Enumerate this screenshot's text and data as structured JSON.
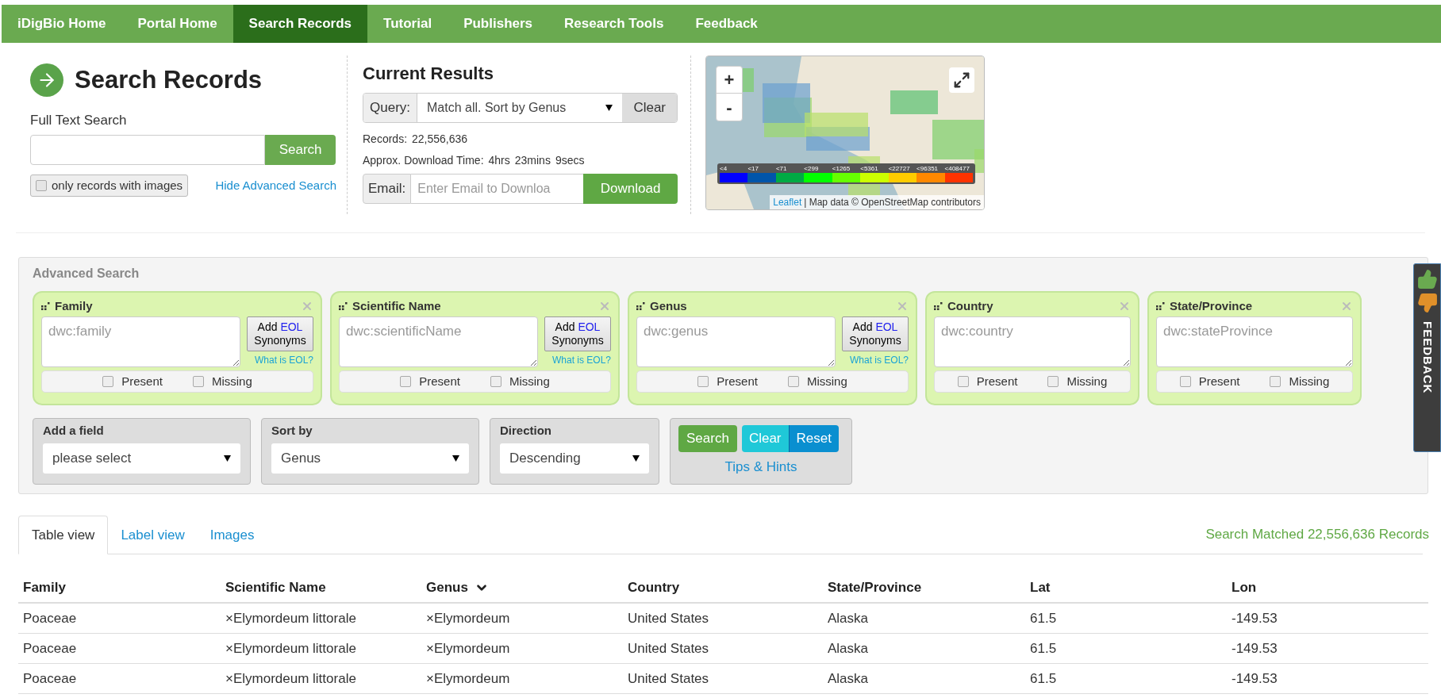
{
  "nav": [
    {
      "label": "iDigBio Home",
      "selected": false
    },
    {
      "label": "Portal Home",
      "selected": false
    },
    {
      "label": "Search Records",
      "selected": true
    },
    {
      "label": "Tutorial",
      "selected": false
    },
    {
      "label": "Publishers",
      "selected": false
    },
    {
      "label": "Research Tools",
      "selected": false
    },
    {
      "label": "Feedback",
      "selected": false
    }
  ],
  "search": {
    "title": "Search Records",
    "label": "Full Text Search",
    "button": "Search",
    "images_only": {
      "label": "only records with images",
      "checked": false
    },
    "advanced_link": "Hide Advanced Search"
  },
  "results": {
    "title": "Current Results",
    "query_label": "Query:",
    "query_value": "Match all. Sort by Genus",
    "clear": "Clear",
    "records_label": "Records:",
    "records": "22,556,636",
    "time_label": "Approx. Download Time:",
    "time_parts": [
      "4hrs",
      "23mins",
      "9secs"
    ],
    "email_label": "Email:",
    "email_placeholder": "Enter Email to Downloa",
    "download": "Download"
  },
  "map": {
    "zoom_in": "+",
    "zoom_out": "-",
    "legend": [
      {
        "label": "<4",
        "color": "#0000ff"
      },
      {
        "label": "<17",
        "color": "#0055aa"
      },
      {
        "label": "<71",
        "color": "#00aa44"
      },
      {
        "label": "<299",
        "color": "#00ff00"
      },
      {
        "label": "<1265",
        "color": "#66ff00"
      },
      {
        "label": "<5361",
        "color": "#ccff00"
      },
      {
        "label": "<22727",
        "color": "#ffcc00"
      },
      {
        "label": "<96351",
        "color": "#ff8800"
      },
      {
        "label": "<408477",
        "color": "#ff3300"
      }
    ],
    "attribution_link": "Leaflet",
    "attribution": "| Map data © OpenStreetMap contributors"
  },
  "advanced": {
    "title": "Advanced Search",
    "fields": [
      {
        "kind": "taxon",
        "name": "Family",
        "placeholder": "dwc:family",
        "eol_add": "Add",
        "eol_name": "EOL",
        "eol_synonyms": "Synonyms",
        "eol_help": "What is EOL?",
        "present": {
          "label": "Present",
          "checked": false
        },
        "missing": {
          "label": "Missing",
          "checked": false
        }
      },
      {
        "kind": "taxon",
        "name": "Scientific Name",
        "placeholder": "dwc:scientificName",
        "eol_add": "Add",
        "eol_name": "EOL",
        "eol_synonyms": "Synonyms",
        "eol_help": "What is EOL?",
        "present": {
          "label": "Present",
          "checked": false
        },
        "missing": {
          "label": "Missing",
          "checked": false
        }
      },
      {
        "kind": "taxon",
        "name": "Genus",
        "placeholder": "dwc:genus",
        "eol_add": "Add",
        "eol_name": "EOL",
        "eol_synonyms": "Synonyms",
        "eol_help": "What is EOL?",
        "present": {
          "label": "Present",
          "checked": false
        },
        "missing": {
          "label": "Missing",
          "checked": false
        }
      },
      {
        "kind": "plain",
        "name": "Country",
        "placeholder": "dwc:country",
        "present": {
          "label": "Present",
          "checked": false
        },
        "missing": {
          "label": "Missing",
          "checked": false
        }
      },
      {
        "kind": "plain",
        "name": "State/Province",
        "placeholder": "dwc:stateProvince",
        "present": {
          "label": "Present",
          "checked": false
        },
        "missing": {
          "label": "Missing",
          "checked": false
        }
      }
    ],
    "selects": [
      {
        "label": "Add a field",
        "value": "please select"
      },
      {
        "label": "Sort by",
        "value": "Genus"
      },
      {
        "label": "Direction",
        "value": "Descending"
      }
    ],
    "search": "Search",
    "clear": "Clear",
    "reset": "Reset",
    "tips": "Tips & Hints"
  },
  "feedback_tab": "FEEDBACK",
  "tabs": [
    {
      "label": "Table view",
      "selected": true
    },
    {
      "label": "Label view",
      "selected": false
    },
    {
      "label": "Images",
      "selected": false
    }
  ],
  "match_count": "Search Matched 22,556,636 Records",
  "table": {
    "columns": [
      {
        "label": "Family",
        "sorted": false
      },
      {
        "label": "Scientific Name",
        "sorted": false
      },
      {
        "label": "Genus",
        "sorted": true
      },
      {
        "label": "Country",
        "sorted": false
      },
      {
        "label": "State/Province",
        "sorted": false
      },
      {
        "label": "Lat",
        "sorted": false
      },
      {
        "label": "Lon",
        "sorted": false
      }
    ],
    "rows": [
      [
        "Poaceae",
        "×Elymordeum littorale",
        "×Elymordeum",
        "United States",
        "Alaska",
        "61.5",
        "-149.53"
      ],
      [
        "Poaceae",
        "×Elymordeum littorale",
        "×Elymordeum",
        "United States",
        "Alaska",
        "61.5",
        "-149.53"
      ],
      [
        "Poaceae",
        "×Elymordeum littorale",
        "×Elymordeum",
        "United States",
        "Alaska",
        "61.5",
        "-149.53"
      ]
    ]
  }
}
